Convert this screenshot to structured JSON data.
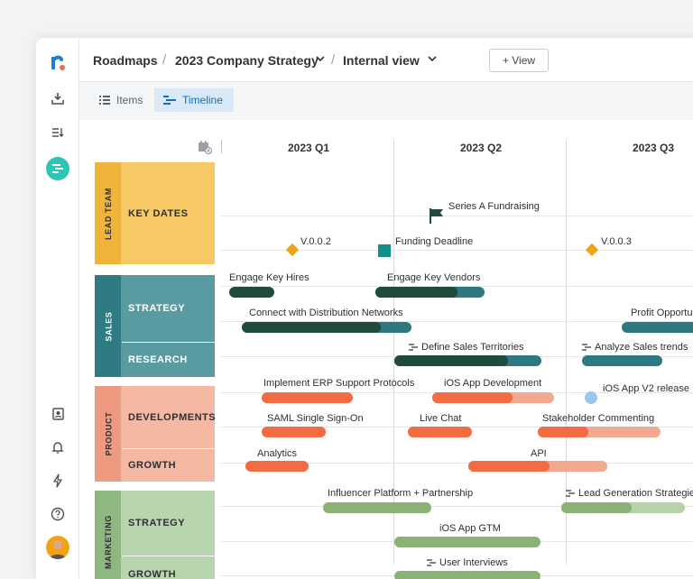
{
  "colors": {
    "accent": "#1b6db3",
    "sidebar_active": "#2ec4b6",
    "lead": "#f6c965",
    "lead_dark": "#f0b43a",
    "sales": "#5a9ba2",
    "sales_dark": "#2f7b84",
    "product": "#f5b8a3",
    "product_dark": "#ee9a80",
    "marketing": "#b9d5ae",
    "marketing_dark": "#8fb880",
    "bar_dark_green": "#1f4a3c",
    "bar_teal": "#2e7882",
    "bar_orange": "#f26b43",
    "bar_orange_light": "#f2a98f",
    "bar_green": "#8ab275",
    "bar_green_light": "#b6d2a6"
  },
  "sidebar": {
    "icons": [
      "logo-icon",
      "download-icon",
      "list-sort-icon",
      "roadmap-icon",
      "contacts-icon",
      "bell-icon",
      "bolt-icon",
      "help-icon",
      "avatar"
    ]
  },
  "breadcrumb": {
    "root": "Roadmaps",
    "sep1": "/",
    "roadmap": "2023 Company Strategy",
    "sep2": "/",
    "view": "Internal view",
    "add_view": "+ View"
  },
  "tabs": {
    "items": "Items",
    "timeline": "Timeline"
  },
  "timeline": {
    "quarters": [
      "2023 Q1",
      "2023 Q2",
      "2023 Q3"
    ],
    "groups": [
      {
        "name": "LEAD TEAM",
        "subs": [
          "KEY DATES"
        ]
      },
      {
        "name": "SALES",
        "subs": [
          "STRATEGY",
          "RESEARCH"
        ]
      },
      {
        "name": "PRODUCT",
        "subs": [
          "DEVELOPMENTS",
          "GROWTH"
        ]
      },
      {
        "name": "MARKETING",
        "subs": [
          "STRATEGY",
          "GROWTH"
        ]
      }
    ],
    "items": {
      "series_a": "Series A Fundraising",
      "v002": "V.0.0.2",
      "funding": "Funding Deadline",
      "v003": "V.0.0.3",
      "engage_hires": "Engage Key Hires",
      "engage_vendors": "Engage Key Vendors",
      "connect": "Connect with Distribution Networks",
      "profit": "Profit Opportu",
      "territories": "Define Sales Territories",
      "analyze": "Analyze Sales trends",
      "erp": "Implement ERP Support Protocols",
      "ios_dev": "iOS App Development",
      "ios_v2": "iOS App V2 release",
      "saml": "SAML Single Sign-On",
      "live_chat": "Live Chat",
      "stakeholder": "Stakeholder Commenting",
      "analytics": "Analytics",
      "api": "API",
      "influencer": "Influencer Platform + Partnership",
      "lead_gen": "Lead Generation Strategies",
      "ios_gtm": "iOS App GTM",
      "interviews": "User Interviews"
    }
  }
}
